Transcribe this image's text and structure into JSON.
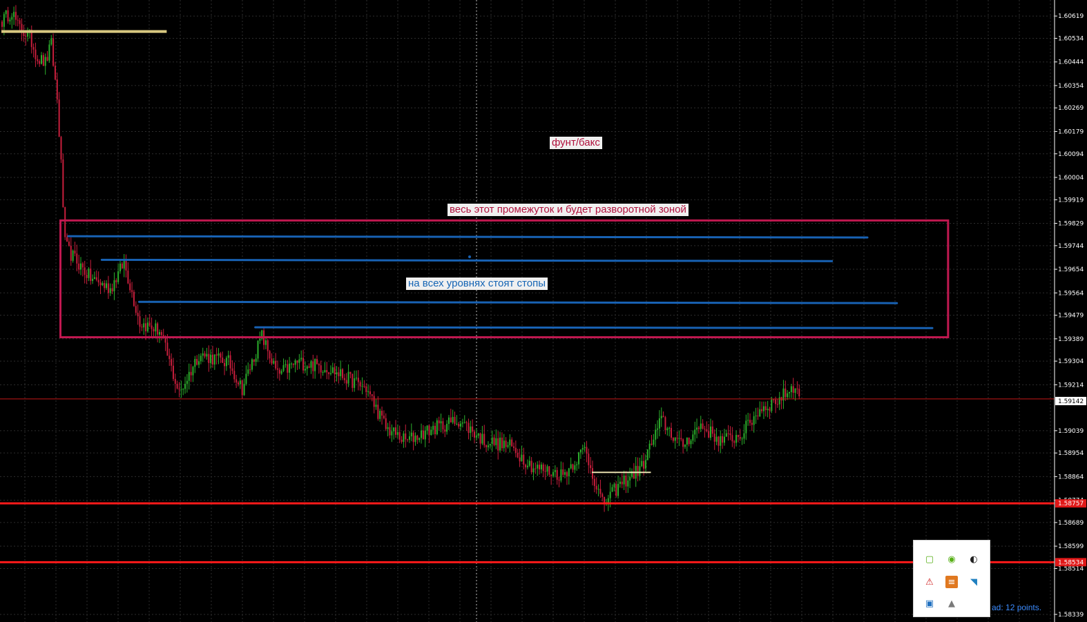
{
  "chart_data": {
    "type": "candlestick",
    "instrument_label": "фунт/бакс",
    "y_axis_ticks": [
      "1.60619",
      "1.60534",
      "1.60444",
      "1.60354",
      "1.60269",
      "1.60179",
      "1.60094",
      "1.60004",
      "1.59919",
      "1.59829",
      "1.59744",
      "1.59654",
      "1.59564",
      "1.59479",
      "1.59389",
      "1.59304",
      "1.59214",
      "1.59039",
      "1.58954",
      "1.58864",
      "1.58774",
      "1.58689",
      "1.58599",
      "1.58514",
      "1.58339"
    ],
    "ylim": [
      1.5831,
      1.6068
    ],
    "price_markers": [
      {
        "value": "1.59142",
        "color": "#ffffff"
      },
      {
        "value": "1.58757",
        "color": "#ff2020"
      },
      {
        "value": "1.58534",
        "color": "#ff2020"
      }
    ],
    "horizontal_lines": [
      {
        "price": 1.5916,
        "color": "#c81818",
        "style": "thin"
      },
      {
        "price": 1.58762,
        "color": "#ff1a1a",
        "style": "thick"
      },
      {
        "price": 1.58538,
        "color": "#ff1a1a",
        "style": "thick"
      }
    ],
    "level_lines": [
      {
        "price": 1.6056,
        "color": "#d8c880",
        "from_bar": 0,
        "to_bar": 84
      },
      {
        "price": 1.5888,
        "color": "#e8e0b0",
        "from_bar": 300,
        "to_bar": 330
      }
    ],
    "stop_levels": [
      {
        "price_start": 1.5978,
        "price_end": 1.59775,
        "from_bar": 34,
        "to_bar": 440
      },
      {
        "price_start": 1.5969,
        "price_end": 1.59685,
        "from_bar": 51,
        "to_bar": 422
      },
      {
        "price_start": 1.5953,
        "price_end": 1.59525,
        "from_bar": 70,
        "to_bar": 455
      },
      {
        "price_start": 1.59433,
        "price_end": 1.5943,
        "from_bar": 129,
        "to_bar": 473
      }
    ],
    "zone": {
      "price_high": 1.5984,
      "price_low": 1.59395,
      "from_bar": 30,
      "to_bar": 481,
      "color": "#c01850"
    },
    "candle_count": 540,
    "anchors": [
      [
        0,
        1.606
      ],
      [
        5,
        1.6064
      ],
      [
        8,
        1.6058
      ],
      [
        14,
        1.6054
      ],
      [
        18,
        1.6046
      ],
      [
        22,
        1.6044
      ],
      [
        25,
        1.6051
      ],
      [
        28,
        1.603
      ],
      [
        30,
        1.6005
      ],
      [
        32,
        1.5975
      ],
      [
        34,
        1.5972
      ],
      [
        45,
        1.5962
      ],
      [
        55,
        1.5958
      ],
      [
        62,
        1.5968
      ],
      [
        70,
        1.5945
      ],
      [
        80,
        1.5942
      ],
      [
        85,
        1.593
      ],
      [
        90,
        1.5918
      ],
      [
        100,
        1.5933
      ],
      [
        115,
        1.593
      ],
      [
        122,
        1.592
      ],
      [
        132,
        1.594
      ],
      [
        140,
        1.5925
      ],
      [
        150,
        1.593
      ],
      [
        165,
        1.5928
      ],
      [
        185,
        1.592
      ],
      [
        195,
        1.5905
      ],
      [
        205,
        1.59
      ],
      [
        220,
        1.5905
      ],
      [
        232,
        1.5908
      ],
      [
        245,
        1.59
      ],
      [
        258,
        1.5898
      ],
      [
        270,
        1.589
      ],
      [
        285,
        1.5887
      ],
      [
        296,
        1.5897
      ],
      [
        305,
        1.5876
      ],
      [
        315,
        1.5884
      ],
      [
        325,
        1.589
      ],
      [
        335,
        1.5908
      ],
      [
        345,
        1.5898
      ],
      [
        355,
        1.5906
      ],
      [
        365,
        1.59
      ],
      [
        375,
        1.5902
      ],
      [
        385,
        1.5912
      ],
      [
        395,
        1.5916
      ],
      [
        402,
        1.5921
      ],
      [
        405,
        1.5917
      ]
    ],
    "grid": true
  },
  "annotations": {
    "pair": "фунт/бакс",
    "zone": "весь этот промежуток и будет разворотной зоной",
    "stops": "на всех уровнях стоят стопы"
  },
  "colors": {
    "bull_candle": "#2cb02c",
    "bear_candle": "#c81e3c",
    "grid": "#2e2e2e",
    "stop_line": "#1862b4",
    "zone_border": "#c01850"
  },
  "tray": {
    "icons": [
      "nvidia-icon",
      "nvidia-icon",
      "steam-icon",
      "warning-icon",
      "stackoverflow-icon",
      "network-icon",
      "clipboard-icon",
      "bell-icon"
    ]
  },
  "status": {
    "text": "ad: 12 points."
  }
}
